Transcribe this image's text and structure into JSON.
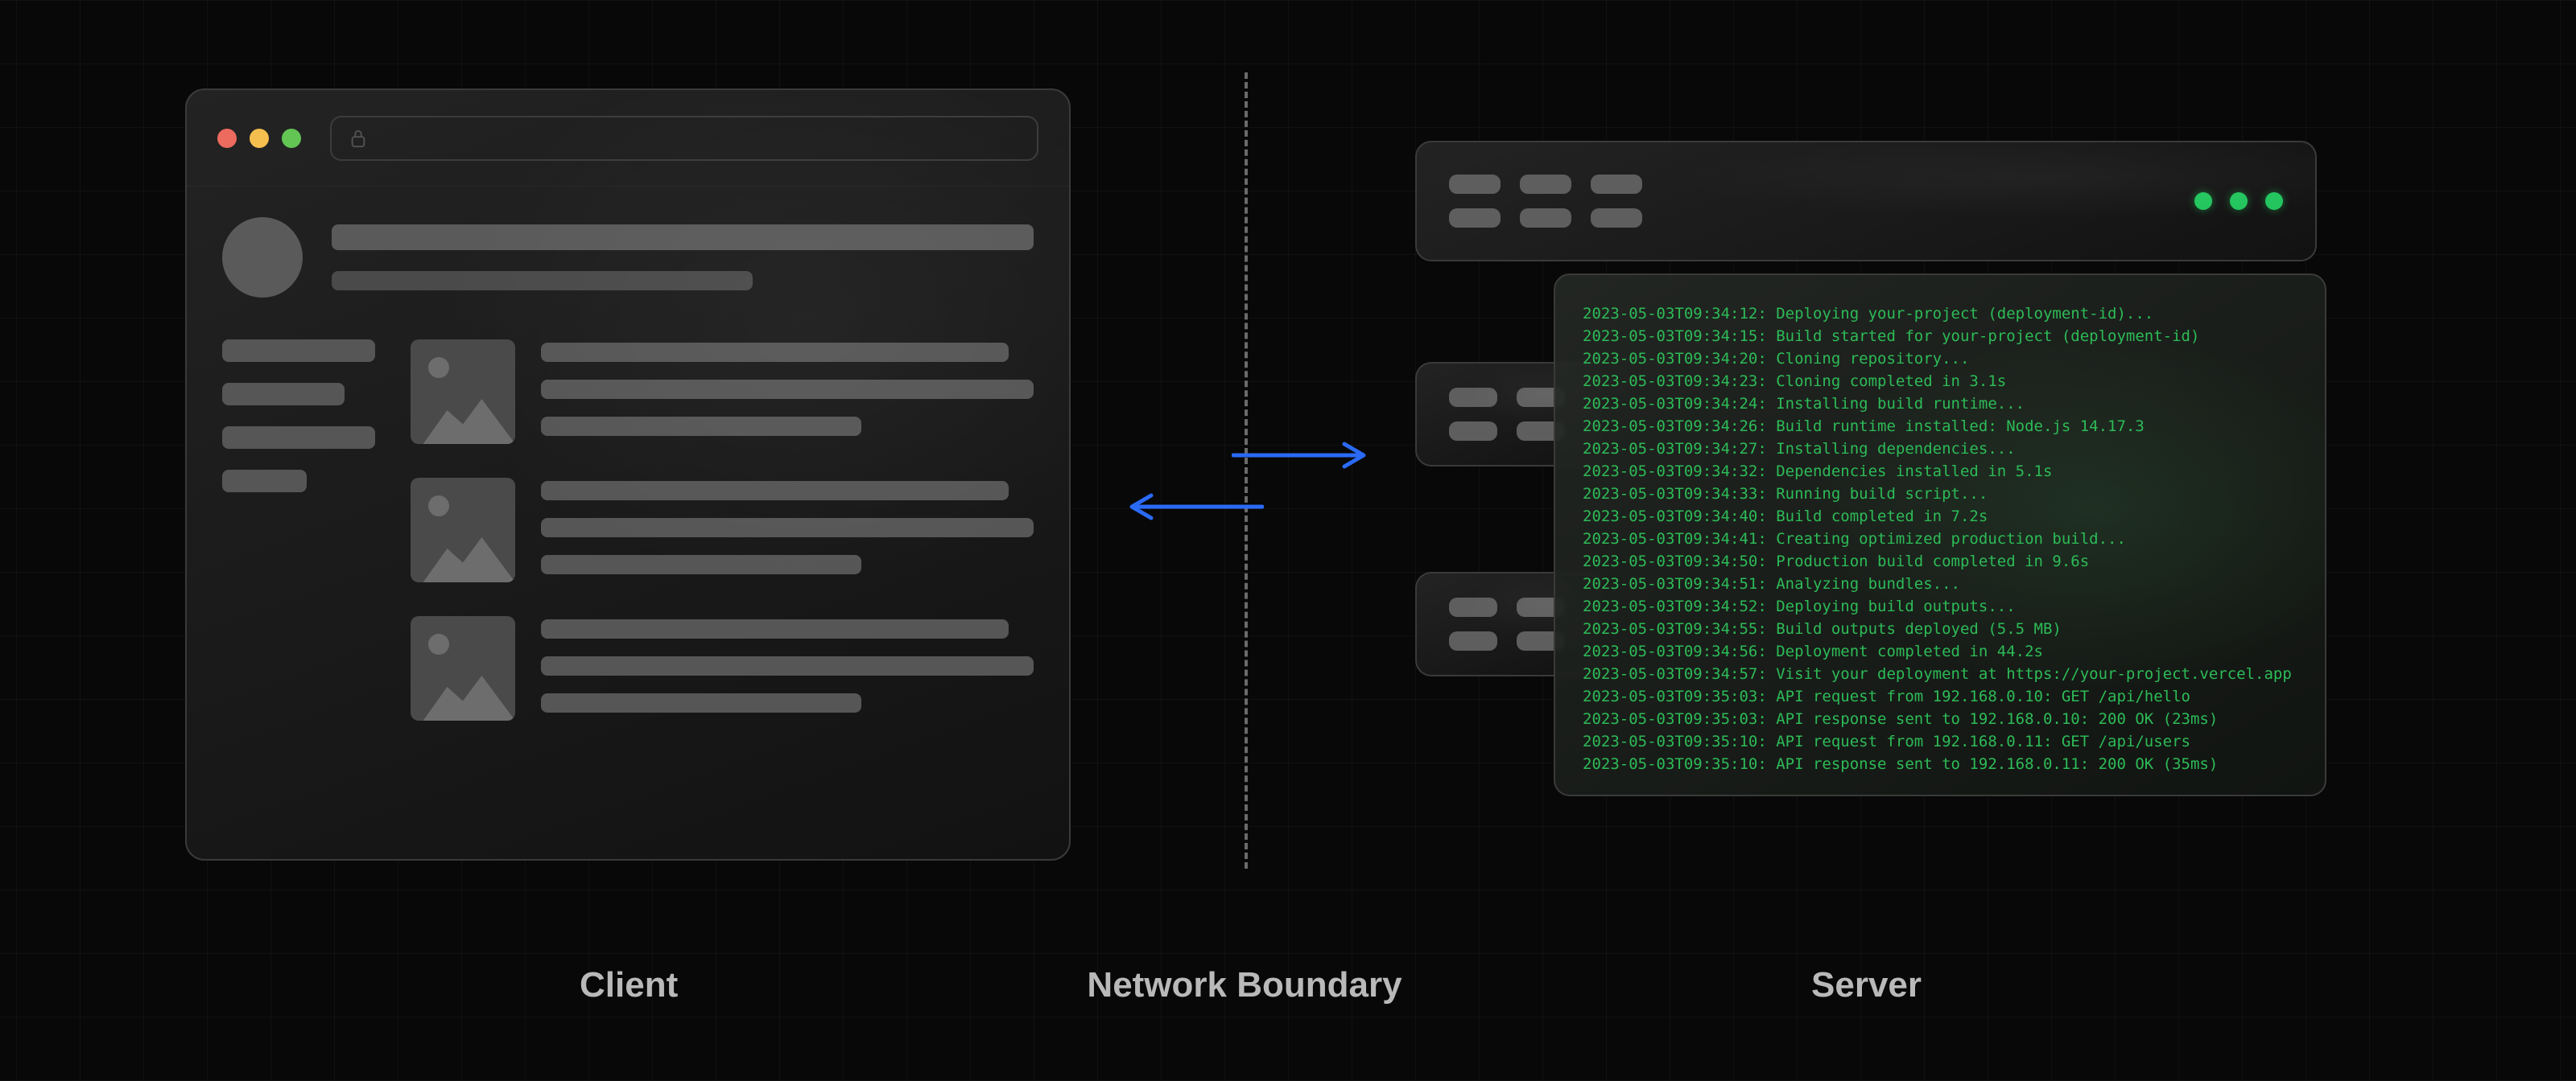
{
  "labels": {
    "client": "Client",
    "network_boundary": "Network Boundary",
    "server": "Server"
  },
  "browser": {
    "traffic_lights": [
      "red",
      "yellow",
      "green"
    ],
    "address_bar": {
      "locked": true,
      "url": ""
    }
  },
  "arrows": {
    "direction_top": "right",
    "direction_bottom": "left",
    "color": "#2a6af5"
  },
  "server_rack": {
    "led_color": "#23c55e",
    "units": 3
  },
  "terminal": {
    "logs": [
      "2023-05-03T09:34:12: Deploying your-project (deployment-id)...",
      "2023-05-03T09:34:15: Build started for your-project (deployment-id)",
      "2023-05-03T09:34:20: Cloning repository...",
      "2023-05-03T09:34:23: Cloning completed in 3.1s",
      "2023-05-03T09:34:24: Installing build runtime...",
      "2023-05-03T09:34:26: Build runtime installed: Node.js 14.17.3",
      "2023-05-03T09:34:27: Installing dependencies...",
      "2023-05-03T09:34:32: Dependencies installed in 5.1s",
      "2023-05-03T09:34:33: Running build script...",
      "2023-05-03T09:34:40: Build completed in 7.2s",
      "2023-05-03T09:34:41: Creating optimized production build...",
      "2023-05-03T09:34:50: Production build completed in 9.6s",
      "2023-05-03T09:34:51: Analyzing bundles...",
      "2023-05-03T09:34:52: Deploying build outputs...",
      "2023-05-03T09:34:55: Build outputs deployed (5.5 MB)",
      "2023-05-03T09:34:56: Deployment completed in 44.2s",
      "2023-05-03T09:34:57: Visit your deployment at https://your-project.vercel.app",
      "2023-05-03T09:35:03: API request from 192.168.0.10: GET /api/hello",
      "2023-05-03T09:35:03: API response sent to 192.168.0.10: 200 OK (23ms)",
      "2023-05-03T09:35:10: API request from 192.168.0.11: GET /api/users",
      "2023-05-03T09:35:10: API response sent to 192.168.0.11: 200 OK (35ms)"
    ]
  }
}
